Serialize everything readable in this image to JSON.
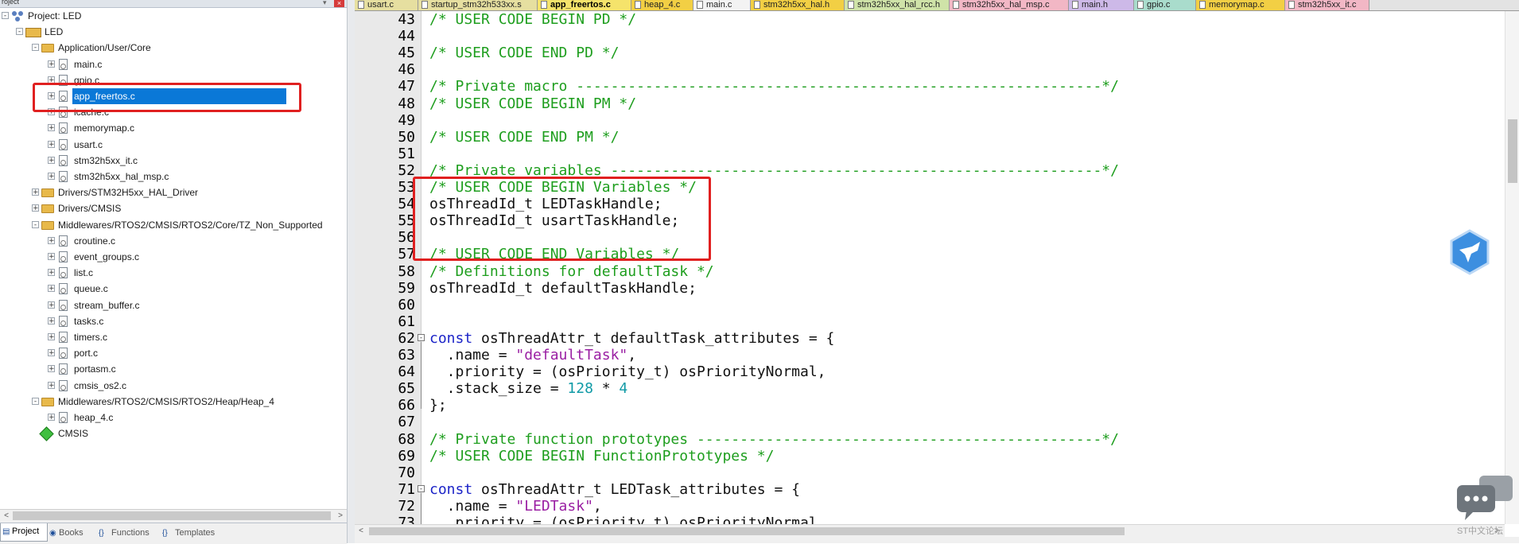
{
  "project_panel": {
    "title": "roject",
    "pin_glyph": "▾",
    "close_glyph": "×",
    "tree": [
      {
        "label": "Project: LED",
        "depth": 0,
        "expander": "-",
        "icon": "project-icon"
      },
      {
        "label": "LED",
        "depth": 1,
        "expander": "-",
        "icon": "target-folder-icon"
      },
      {
        "label": "Application/User/Core",
        "depth": 2,
        "expander": "-",
        "icon": "folder-icon"
      },
      {
        "label": "main.c",
        "depth": 3,
        "expander": "+",
        "icon": "c-file-icon"
      },
      {
        "label": "gpio.c",
        "depth": 3,
        "expander": "+",
        "icon": "c-file-icon"
      },
      {
        "label": "app_freertos.c",
        "depth": 3,
        "expander": "+",
        "icon": "c-file-icon",
        "selected": true
      },
      {
        "label": "icache.c",
        "depth": 3,
        "expander": "+",
        "icon": "c-file-icon"
      },
      {
        "label": "memorymap.c",
        "depth": 3,
        "expander": "+",
        "icon": "c-file-icon"
      },
      {
        "label": "usart.c",
        "depth": 3,
        "expander": "+",
        "icon": "c-file-icon"
      },
      {
        "label": "stm32h5xx_it.c",
        "depth": 3,
        "expander": "+",
        "icon": "c-file-icon"
      },
      {
        "label": "stm32h5xx_hal_msp.c",
        "depth": 3,
        "expander": "+",
        "icon": "c-file-icon"
      },
      {
        "label": "Drivers/STM32H5xx_HAL_Driver",
        "depth": 2,
        "expander": "+",
        "icon": "folder-icon"
      },
      {
        "label": "Drivers/CMSIS",
        "depth": 2,
        "expander": "+",
        "icon": "folder-icon"
      },
      {
        "label": "Middlewares/RTOS2/CMSIS/RTOS2/Core/TZ_Non_Supported",
        "depth": 2,
        "expander": "-",
        "icon": "folder-icon"
      },
      {
        "label": "croutine.c",
        "depth": 3,
        "expander": "+",
        "icon": "c-file-icon"
      },
      {
        "label": "event_groups.c",
        "depth": 3,
        "expander": "+",
        "icon": "c-file-icon"
      },
      {
        "label": "list.c",
        "depth": 3,
        "expander": "+",
        "icon": "c-file-icon"
      },
      {
        "label": "queue.c",
        "depth": 3,
        "expander": "+",
        "icon": "c-file-icon"
      },
      {
        "label": "stream_buffer.c",
        "depth": 3,
        "expander": "+",
        "icon": "c-file-icon"
      },
      {
        "label": "tasks.c",
        "depth": 3,
        "expander": "+",
        "icon": "c-file-icon"
      },
      {
        "label": "timers.c",
        "depth": 3,
        "expander": "+",
        "icon": "c-file-icon"
      },
      {
        "label": "port.c",
        "depth": 3,
        "expander": "+",
        "icon": "c-file-icon"
      },
      {
        "label": "portasm.c",
        "depth": 3,
        "expander": "+",
        "icon": "c-file-icon"
      },
      {
        "label": "cmsis_os2.c",
        "depth": 3,
        "expander": "+",
        "icon": "c-file-icon"
      },
      {
        "label": "Middlewares/RTOS2/CMSIS/RTOS2/Heap/Heap_4",
        "depth": 2,
        "expander": "-",
        "icon": "folder-icon"
      },
      {
        "label": "heap_4.c",
        "depth": 3,
        "expander": "+",
        "icon": "c-file-icon"
      },
      {
        "label": "CMSIS",
        "depth": 2,
        "expander": "",
        "icon": "cmsis-gem-icon"
      }
    ],
    "bottom_tabs": [
      {
        "label": "Project",
        "icon": "project-tab-icon",
        "glyph": "▤",
        "active": true
      },
      {
        "label": "Books",
        "icon": "books-icon",
        "glyph": "◉",
        "active": false
      },
      {
        "label": "Functions",
        "icon": "functions-icon",
        "glyph": "{}",
        "active": false
      },
      {
        "label": "Templates",
        "icon": "templates-icon",
        "glyph": "{}",
        "active": false
      }
    ]
  },
  "editor": {
    "tabs": [
      {
        "label": "usart.c",
        "color": "#e6dfa0"
      },
      {
        "label": "startup_stm32h533xx.s",
        "color": "#e6dfa0"
      },
      {
        "label": "app_freertos.c",
        "color": "#f5e36b",
        "active": true
      },
      {
        "label": "heap_4.c",
        "color": "#f2cf44"
      },
      {
        "label": "main.c",
        "color": "#f3f3f3"
      },
      {
        "label": "stm32h5xx_hal.h",
        "color": "#f2cf44"
      },
      {
        "label": "stm32h5xx_hal_rcc.h",
        "color": "#cfe3a8"
      },
      {
        "label": "stm32h5xx_hal_msp.c",
        "color": "#f2b7c5"
      },
      {
        "label": "main.h",
        "color": "#cdb9e8"
      },
      {
        "label": "gpio.c",
        "color": "#a9dccc"
      },
      {
        "label": "memorymap.c",
        "color": "#f2cf44"
      },
      {
        "label": "stm32h5xx_it.c",
        "color": "#f2b7c5"
      }
    ],
    "tab_menu_glyph": "▾",
    "tab_close_glyph": "×",
    "lines": [
      {
        "n": "43",
        "parts": [
          {
            "t": "/* USER CODE BEGIN PD */",
            "c": "cm"
          }
        ]
      },
      {
        "n": "44",
        "parts": []
      },
      {
        "n": "45",
        "parts": [
          {
            "t": "/* USER CODE END PD */",
            "c": "cm"
          }
        ]
      },
      {
        "n": "46",
        "parts": []
      },
      {
        "n": "47",
        "parts": [
          {
            "t": "/* Private macro -------------------------------------------------------------*/",
            "c": "cm"
          }
        ]
      },
      {
        "n": "48",
        "parts": [
          {
            "t": "/* USER CODE BEGIN PM */",
            "c": "cm"
          }
        ]
      },
      {
        "n": "49",
        "parts": []
      },
      {
        "n": "50",
        "parts": [
          {
            "t": "/* USER CODE END PM */",
            "c": "cm"
          }
        ]
      },
      {
        "n": "51",
        "parts": []
      },
      {
        "n": "52",
        "parts": [
          {
            "t": "/* Private variables ---------------------------------------------------------*/",
            "c": "cm"
          }
        ]
      },
      {
        "n": "53",
        "parts": [
          {
            "t": "/* USER CODE BEGIN Variables */",
            "c": "cm"
          }
        ]
      },
      {
        "n": "54",
        "parts": [
          {
            "t": "osThreadId_t LEDTaskHandle;",
            "c": "tx"
          }
        ]
      },
      {
        "n": "55",
        "parts": [
          {
            "t": "osThreadId_t usartTaskHandle;",
            "c": "tx"
          }
        ]
      },
      {
        "n": "56",
        "parts": []
      },
      {
        "n": "57",
        "parts": [
          {
            "t": "/* USER CODE END Variables */",
            "c": "cm"
          }
        ]
      },
      {
        "n": "58",
        "parts": [
          {
            "t": "/* Definitions for defaultTask */",
            "c": "cm"
          }
        ]
      },
      {
        "n": "59",
        "parts": [
          {
            "t": "osThreadId_t defaultTaskHandle;",
            "c": "tx"
          }
        ]
      },
      {
        "n": "60",
        "parts": []
      },
      {
        "n": "61",
        "parts": []
      },
      {
        "n": "62",
        "fold": "-",
        "parts": [
          {
            "t": "const",
            "c": "kw"
          },
          {
            "t": " osThreadAttr_t defaultTask_attributes = {",
            "c": "tx"
          }
        ]
      },
      {
        "n": "63",
        "parts": [
          {
            "t": "  .name = ",
            "c": "tx"
          },
          {
            "t": "\"defaultTask\"",
            "c": "str"
          },
          {
            "t": ",",
            "c": "tx"
          }
        ]
      },
      {
        "n": "64",
        "parts": [
          {
            "t": "  .priority = (osPriority_t) osPriorityNormal,",
            "c": "tx"
          }
        ]
      },
      {
        "n": "65",
        "parts": [
          {
            "t": "  .stack_size = ",
            "c": "tx"
          },
          {
            "t": "128",
            "c": "num"
          },
          {
            "t": " * ",
            "c": "tx"
          },
          {
            "t": "4",
            "c": "num"
          }
        ]
      },
      {
        "n": "66",
        "parts": [
          {
            "t": "};",
            "c": "tx"
          }
        ]
      },
      {
        "n": "67",
        "parts": []
      },
      {
        "n": "68",
        "parts": [
          {
            "t": "/* Private function prototypes -----------------------------------------------*/",
            "c": "cm"
          }
        ]
      },
      {
        "n": "69",
        "parts": [
          {
            "t": "/* USER CODE BEGIN FunctionPrototypes */",
            "c": "cm"
          }
        ]
      },
      {
        "n": "70",
        "parts": []
      },
      {
        "n": "71",
        "fold": "-",
        "parts": [
          {
            "t": "const",
            "c": "kw"
          },
          {
            "t": " osThreadAttr_t LEDTask_attributes = {",
            "c": "tx"
          }
        ]
      },
      {
        "n": "72",
        "parts": [
          {
            "t": "  .name = ",
            "c": "tx"
          },
          {
            "t": "\"LEDTask\"",
            "c": "str"
          },
          {
            "t": ",",
            "c": "tx"
          }
        ]
      },
      {
        "n": "73",
        "parts": [
          {
            "t": "  .priority = (osPriority_t) osPriorityNormal,",
            "c": "tx"
          }
        ]
      }
    ]
  },
  "scroll_arrows": {
    "left": "<",
    "right": ">"
  },
  "watermark": "ST中文论坛",
  "colors": {
    "selection": "#0a78d7",
    "highlight_box": "#e02020",
    "comment": "#1e9e1e",
    "keyword": "#1c24c8",
    "string": "#9a1fa3",
    "number": "#0f9aa6"
  }
}
